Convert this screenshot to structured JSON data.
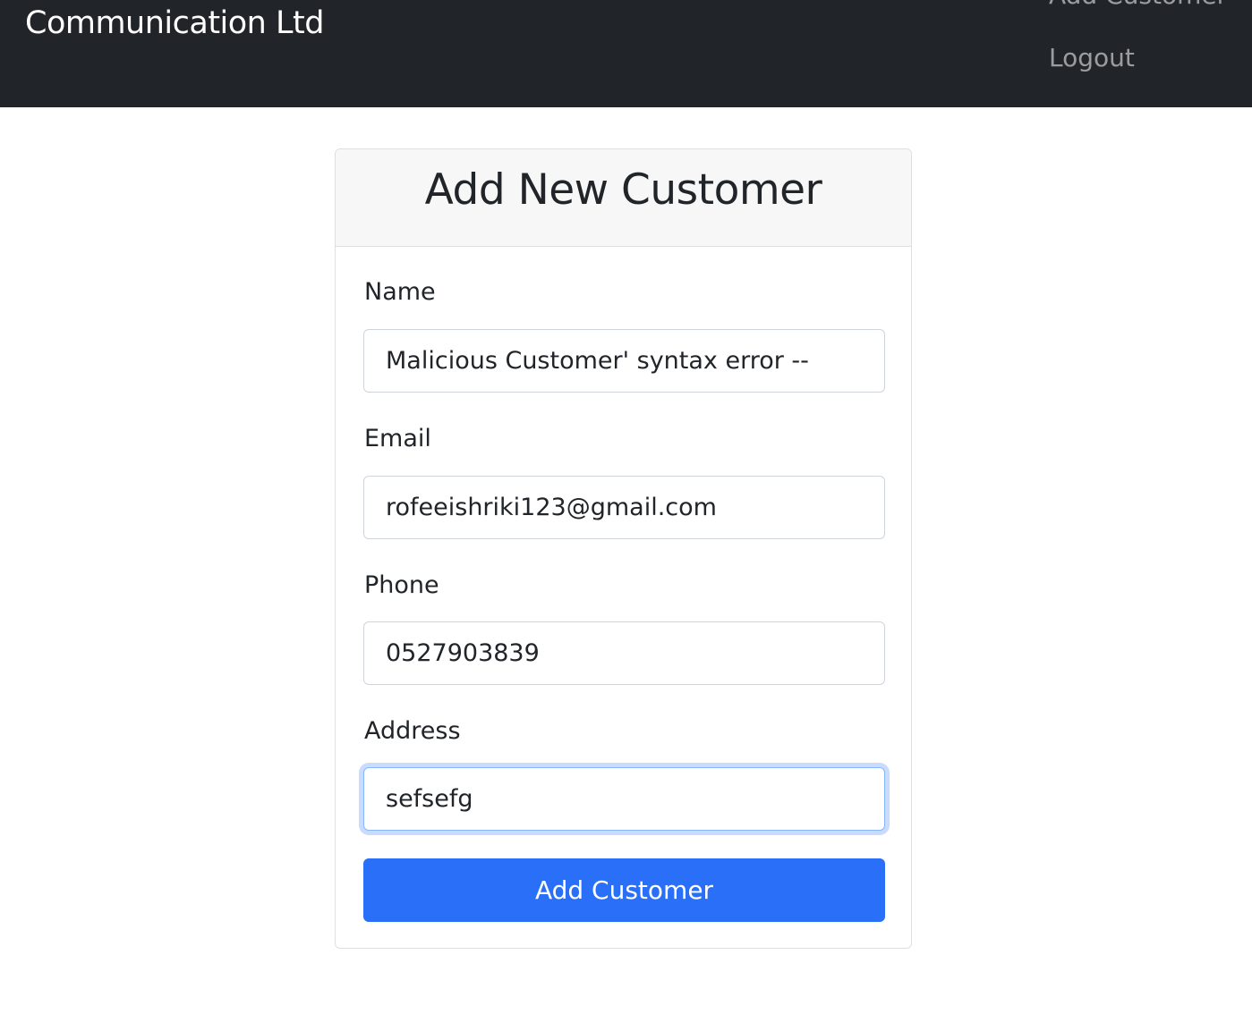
{
  "navbar": {
    "brand": "Communication Ltd",
    "links": [
      "Add Customer",
      "Logout"
    ]
  },
  "form": {
    "title": "Add New Customer",
    "fields": [
      {
        "label": "Name",
        "value": "Malicious Customer' syntax error --"
      },
      {
        "label": "Email",
        "value": "rofeeishriki123@gmail.com"
      },
      {
        "label": "Phone",
        "value": "0527903839"
      },
      {
        "label": "Address",
        "value": "sefsefg",
        "focused": true
      }
    ],
    "submit_label": "Add Customer"
  },
  "colors": {
    "navbar": "#212529",
    "primary": "#2a6ff7"
  }
}
